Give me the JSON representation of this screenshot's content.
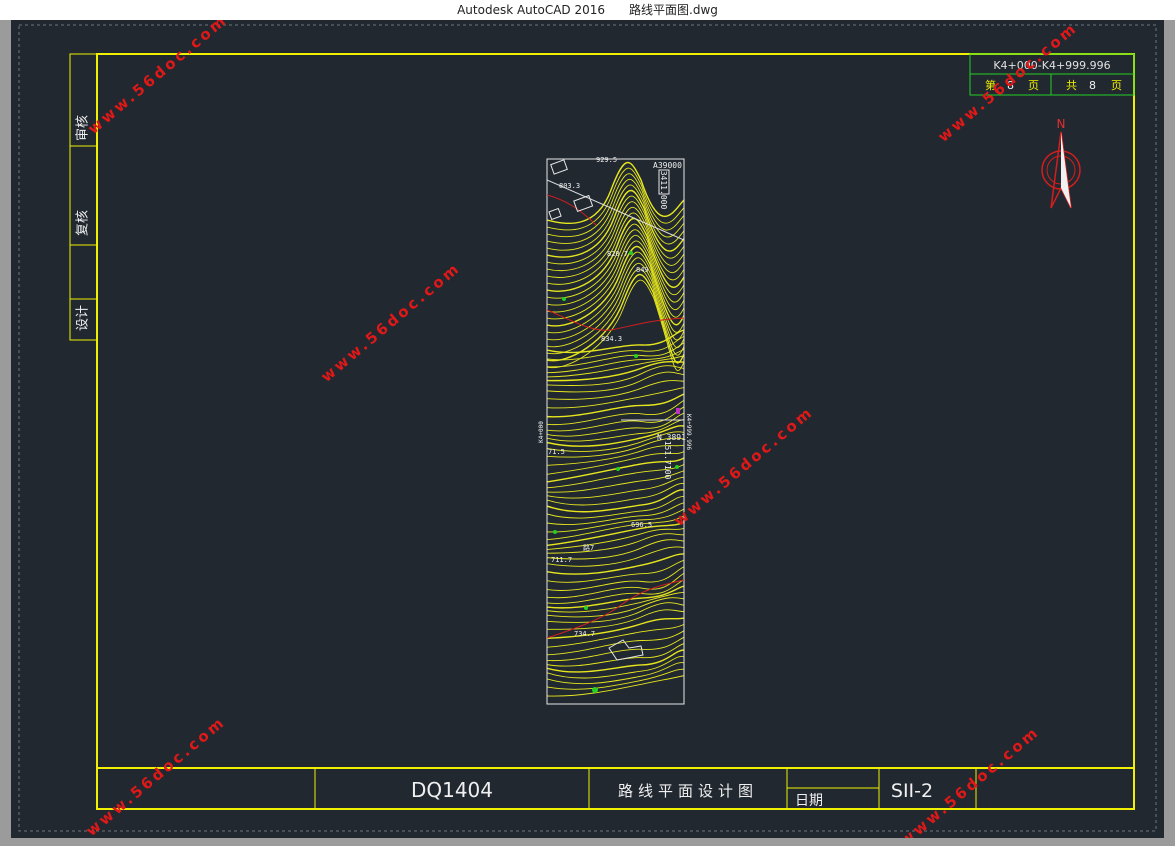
{
  "window": {
    "title": "Autodesk AutoCAD 2016　　路线平面图.dwg"
  },
  "side_panel": {
    "review": "审核",
    "recheck": "复核",
    "design": "设计"
  },
  "top_right_table": {
    "station_range": "K4+000-K4+999.996",
    "page_prefix": "第",
    "page_number": "8",
    "page_unit": "页",
    "total_prefix": "共",
    "total_number": "8",
    "total_unit": "页"
  },
  "north_arrow": {
    "label": "N"
  },
  "title_block": {
    "code": "DQ1404",
    "drawing_title": "路线平面设计图",
    "date_label": "日期",
    "sheet_number": "SII-2"
  },
  "map": {
    "elevations": [
      "803.3",
      "820.7",
      "834.3",
      "71.5",
      "696.5",
      "711.7",
      "734.7",
      "929.5",
      "849"
    ],
    "station_start": "K4+000",
    "station_end": "K4+999.996",
    "coord_top": "A39000",
    "coord_mid": "N 3891",
    "coord_rotated_top": "3411.000",
    "coord_rotated_mid": "151.7100",
    "point_label": "路7"
  },
  "watermark": {
    "text": "www.56doc.com"
  },
  "colors": {
    "background": "#212830",
    "frame": "#f0f000",
    "contour": "#e6e61e",
    "grid_green": "#23d023",
    "road_red": "#d21e1e"
  }
}
